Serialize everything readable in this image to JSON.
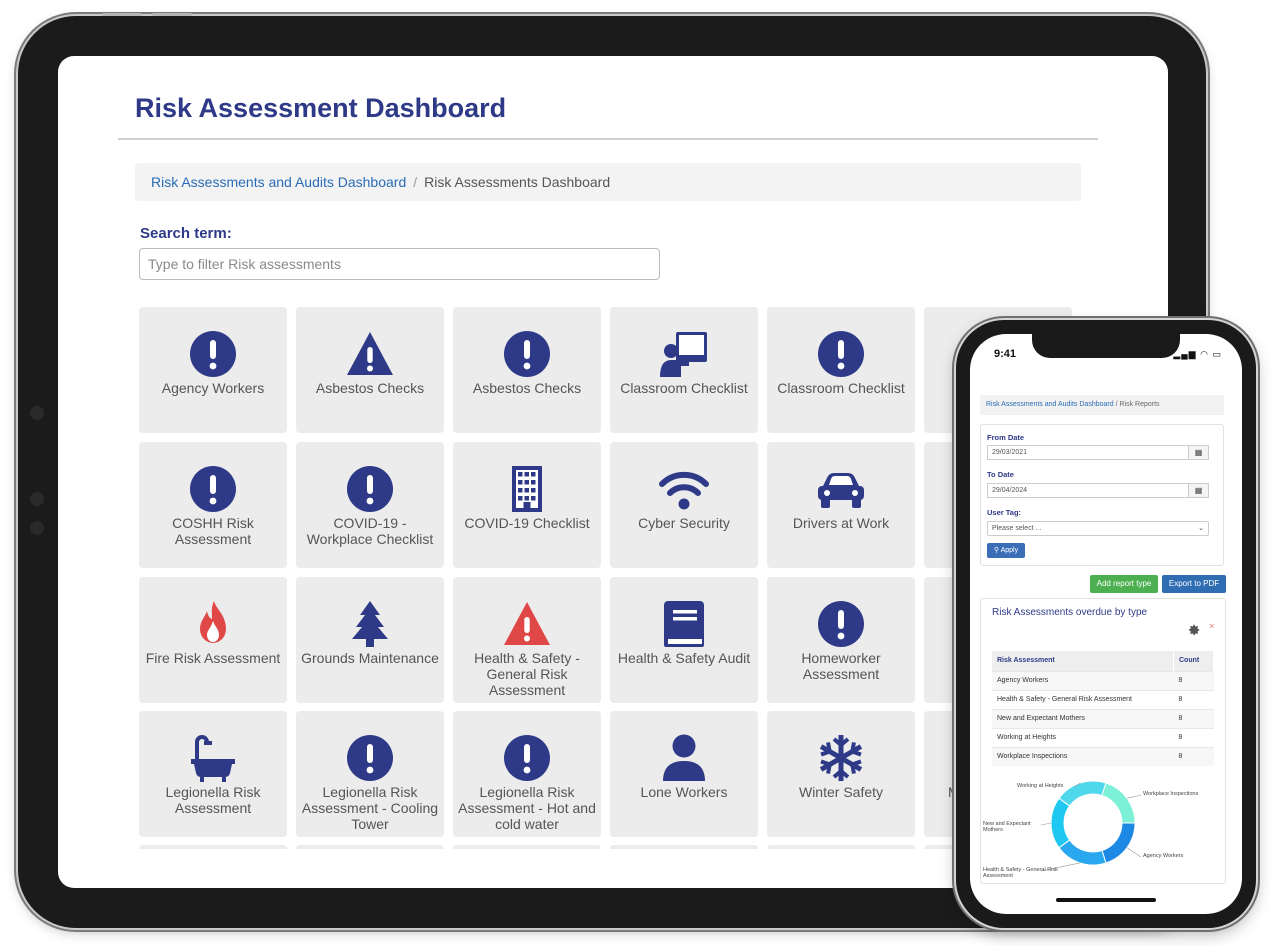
{
  "tablet": {
    "title": "Risk Assessment Dashboard",
    "breadcrumb": {
      "link": "Risk Assessments and Audits Dashboard",
      "separator": "/",
      "current": "Risk Assessments Dashboard"
    },
    "search": {
      "label": "Search term:",
      "placeholder": "Type to filter Risk assessments",
      "value": ""
    },
    "tiles": [
      {
        "label": "Agency Workers",
        "icon": "exclamation-circle-icon"
      },
      {
        "label": "Asbestos Checks",
        "icon": "warning-triangle-icon"
      },
      {
        "label": "Asbestos Checks",
        "icon": "exclamation-circle-icon"
      },
      {
        "label": "Classroom Checklist",
        "icon": "teacher-board-icon"
      },
      {
        "label": "Classroom Checklist",
        "icon": "exclamation-circle-icon"
      },
      {
        "label": "COSHH Risk Assessment",
        "icon": "exclamation-circle-icon"
      },
      {
        "label": "COVID-19 - Workplace Checklist",
        "icon": "exclamation-circle-icon"
      },
      {
        "label": "COVID-19 Checklist",
        "icon": "building-icon"
      },
      {
        "label": "Cyber Security",
        "icon": "wifi-icon"
      },
      {
        "label": "Drivers at Work",
        "icon": "car-icon"
      },
      {
        "label": "Fire Risk Assessment",
        "icon": "fire-icon"
      },
      {
        "label": "Grounds Maintenance",
        "icon": "tree-icon"
      },
      {
        "label": "Health & Safety - General Risk Assessment",
        "icon": "warning-triangle-red-icon"
      },
      {
        "label": "Health & Safety Audit",
        "icon": "book-icon"
      },
      {
        "label": "Homeworker Assessment",
        "icon": "exclamation-circle-icon"
      },
      {
        "label": "Legionella Risk Assessment",
        "icon": "bathtub-icon"
      },
      {
        "label": "Legionella Risk Assessment - Cooling Tower",
        "icon": "exclamation-circle-icon"
      },
      {
        "label": "Legionella Risk Assessment - Hot and cold water",
        "icon": "exclamation-circle-icon"
      },
      {
        "label": "Lone Workers",
        "icon": "user-icon"
      },
      {
        "label": "Winter Safety",
        "icon": "snowflake-icon"
      }
    ],
    "partial_row4_text": "M"
  },
  "phone": {
    "time": "9:41",
    "breadcrumb": {
      "link": "Risk Assessments and Audits Dashboard",
      "separator": "/",
      "current": "Risk Reports"
    },
    "from_label": "From Date",
    "from_value": "29/03/2021",
    "to_label": "To Date",
    "to_value": "29/04/2024",
    "user_tag_label": "User Tag:",
    "user_tag_value": "Please select ...",
    "apply_label": "Apply",
    "add_report_label": "Add report type",
    "export_label": "Export to PDF",
    "panel_title": "Risk Assessments overdue by type",
    "close_label": "×",
    "table": {
      "headers": [
        "Risk Assessment",
        "Count"
      ],
      "rows": [
        [
          "Agency Workers",
          "8"
        ],
        [
          "Health & Safety - General Risk Assessment",
          "8"
        ],
        [
          "New and Expectant Mothers",
          "8"
        ],
        [
          "Working at Heights",
          "8"
        ],
        [
          "Workplace Inspections",
          "8"
        ]
      ]
    }
  },
  "colors": {
    "navy": "#2e3a87",
    "link": "#2a6cb5",
    "red": "#e04848",
    "tile_bg": "#ececec",
    "green_btn": "#4caf50",
    "blue_btn": "#2f6db3"
  },
  "chart_data": {
    "type": "pie",
    "categories": [
      "Agency Workers",
      "Health & Safety - General Risk Assessment",
      "New and Expectant Mothers",
      "Working at Heights",
      "Workplace Inspections"
    ],
    "values": [
      8,
      8,
      8,
      8,
      8
    ],
    "colors": [
      "#1e88e5",
      "#29a8f0",
      "#1ec8f0",
      "#4fd8ec",
      "#7df0d8"
    ],
    "donut": true,
    "legend": "callout-labels"
  }
}
